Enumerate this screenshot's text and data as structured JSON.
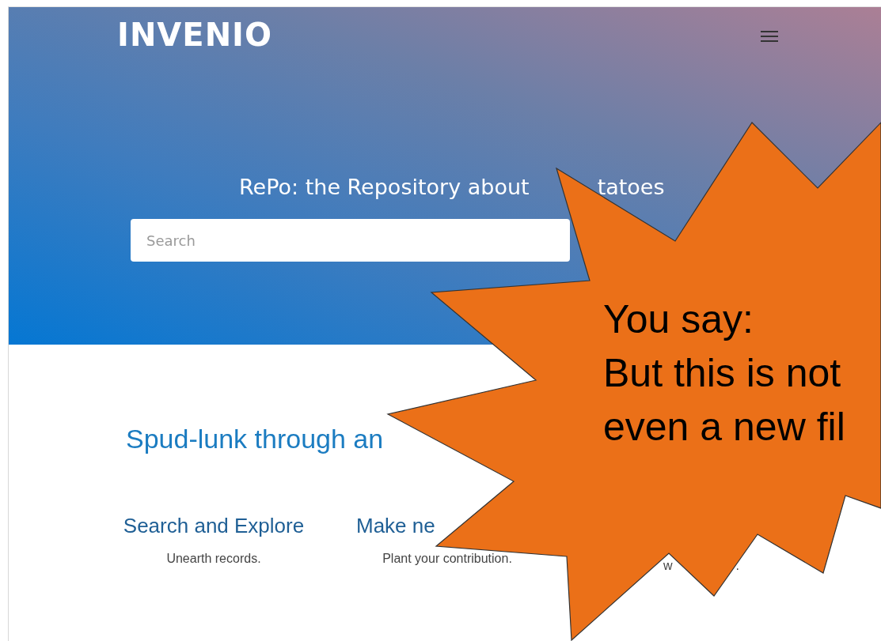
{
  "header": {
    "logo": "INVENIO"
  },
  "hero": {
    "title_start": "RePo: the Repository about",
    "title_end": "tatoes",
    "search": {
      "placeholder": "Search"
    }
  },
  "section": {
    "heading": "Spud-lunk through an"
  },
  "features": [
    {
      "kind": "full",
      "title": "Search and Explore",
      "description": [
        "Unearth records."
      ]
    },
    {
      "kind": "cut",
      "title": "Make ne",
      "description": [
        "Plant your contribution."
      ]
    },
    {
      "kind": "fragments",
      "description": [
        "w",
        "."
      ]
    }
  ],
  "callout": {
    "lines": [
      "You say:",
      "But this is not",
      "even a new fil"
    ]
  }
}
